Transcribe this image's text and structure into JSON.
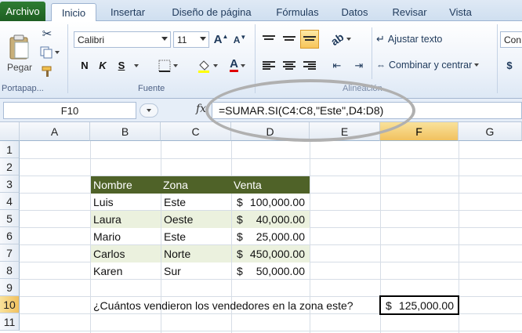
{
  "tabs": {
    "file": "Archivo",
    "items": [
      "Inicio",
      "Insertar",
      "Diseño de página",
      "Fórmulas",
      "Datos",
      "Revisar",
      "Vista"
    ]
  },
  "ribbon": {
    "clipboard": {
      "paste_label": "Pegar",
      "group_label": "Portapap..."
    },
    "font": {
      "name": "Calibri",
      "size": "11",
      "group_label": "Fuente",
      "bold": "N",
      "italic": "K",
      "underline": "S"
    },
    "alignment": {
      "wrap_text": "Ajustar texto",
      "merge_center": "Combinar y centrar",
      "group_label": "Alineación"
    },
    "number": {
      "format_partial": "Con",
      "currency_symbol": "$"
    }
  },
  "formula_bar": {
    "name_box": "F10",
    "fx": "fx",
    "formula": "=SUMAR.SI(C4:C8,\"Este\",D4:D8)"
  },
  "columns": [
    "A",
    "B",
    "C",
    "D",
    "E",
    "F",
    "G"
  ],
  "rows": [
    "1",
    "2",
    "3",
    "4",
    "5",
    "6",
    "7",
    "8",
    "9",
    "10",
    "11"
  ],
  "table": {
    "headers": [
      "Nombre",
      "Zona",
      "Venta"
    ],
    "rows": [
      {
        "nombre": "Luis",
        "zona": "Este",
        "symbol": "$",
        "venta": "100,000.00"
      },
      {
        "nombre": "Laura",
        "zona": "Oeste",
        "symbol": "$",
        "venta": "40,000.00"
      },
      {
        "nombre": "Mario",
        "zona": "Este",
        "symbol": "$",
        "venta": "25,000.00"
      },
      {
        "nombre": "Carlos",
        "zona": "Norte",
        "symbol": "$",
        "venta": "450,000.00"
      },
      {
        "nombre": "Karen",
        "zona": "Sur",
        "symbol": "$",
        "venta": "50,000.00"
      }
    ]
  },
  "question": "¿Cuántos vendieron los vendedores en la zona este?",
  "result": {
    "symbol": "$",
    "value": "125,000.00"
  },
  "colors": {
    "table_header": "#4f6228",
    "band": "#ebf1de",
    "file_tab": "#2e7d32"
  }
}
